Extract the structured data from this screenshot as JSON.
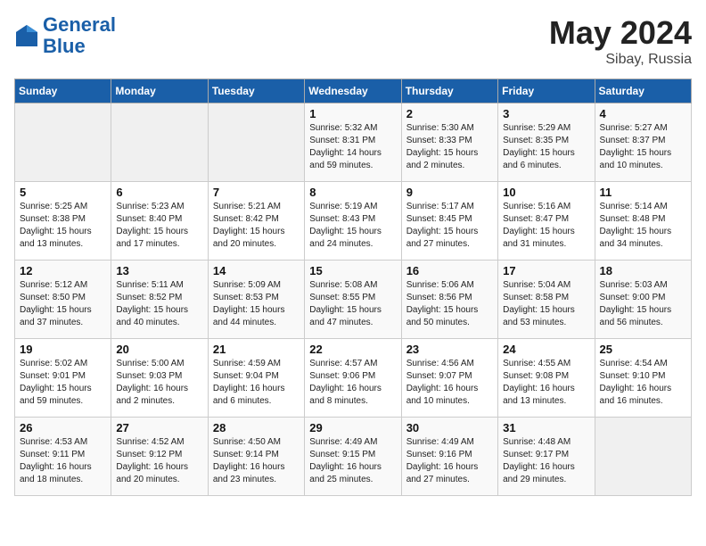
{
  "logo": {
    "line1": "General",
    "line2": "Blue"
  },
  "title": "May 2024",
  "location": "Sibay, Russia",
  "days_header": [
    "Sunday",
    "Monday",
    "Tuesday",
    "Wednesday",
    "Thursday",
    "Friday",
    "Saturday"
  ],
  "weeks": [
    [
      {
        "day": "",
        "info": ""
      },
      {
        "day": "",
        "info": ""
      },
      {
        "day": "",
        "info": ""
      },
      {
        "day": "1",
        "info": "Sunrise: 5:32 AM\nSunset: 8:31 PM\nDaylight: 14 hours\nand 59 minutes."
      },
      {
        "day": "2",
        "info": "Sunrise: 5:30 AM\nSunset: 8:33 PM\nDaylight: 15 hours\nand 2 minutes."
      },
      {
        "day": "3",
        "info": "Sunrise: 5:29 AM\nSunset: 8:35 PM\nDaylight: 15 hours\nand 6 minutes."
      },
      {
        "day": "4",
        "info": "Sunrise: 5:27 AM\nSunset: 8:37 PM\nDaylight: 15 hours\nand 10 minutes."
      }
    ],
    [
      {
        "day": "5",
        "info": "Sunrise: 5:25 AM\nSunset: 8:38 PM\nDaylight: 15 hours\nand 13 minutes."
      },
      {
        "day": "6",
        "info": "Sunrise: 5:23 AM\nSunset: 8:40 PM\nDaylight: 15 hours\nand 17 minutes."
      },
      {
        "day": "7",
        "info": "Sunrise: 5:21 AM\nSunset: 8:42 PM\nDaylight: 15 hours\nand 20 minutes."
      },
      {
        "day": "8",
        "info": "Sunrise: 5:19 AM\nSunset: 8:43 PM\nDaylight: 15 hours\nand 24 minutes."
      },
      {
        "day": "9",
        "info": "Sunrise: 5:17 AM\nSunset: 8:45 PM\nDaylight: 15 hours\nand 27 minutes."
      },
      {
        "day": "10",
        "info": "Sunrise: 5:16 AM\nSunset: 8:47 PM\nDaylight: 15 hours\nand 31 minutes."
      },
      {
        "day": "11",
        "info": "Sunrise: 5:14 AM\nSunset: 8:48 PM\nDaylight: 15 hours\nand 34 minutes."
      }
    ],
    [
      {
        "day": "12",
        "info": "Sunrise: 5:12 AM\nSunset: 8:50 PM\nDaylight: 15 hours\nand 37 minutes."
      },
      {
        "day": "13",
        "info": "Sunrise: 5:11 AM\nSunset: 8:52 PM\nDaylight: 15 hours\nand 40 minutes."
      },
      {
        "day": "14",
        "info": "Sunrise: 5:09 AM\nSunset: 8:53 PM\nDaylight: 15 hours\nand 44 minutes."
      },
      {
        "day": "15",
        "info": "Sunrise: 5:08 AM\nSunset: 8:55 PM\nDaylight: 15 hours\nand 47 minutes."
      },
      {
        "day": "16",
        "info": "Sunrise: 5:06 AM\nSunset: 8:56 PM\nDaylight: 15 hours\nand 50 minutes."
      },
      {
        "day": "17",
        "info": "Sunrise: 5:04 AM\nSunset: 8:58 PM\nDaylight: 15 hours\nand 53 minutes."
      },
      {
        "day": "18",
        "info": "Sunrise: 5:03 AM\nSunset: 9:00 PM\nDaylight: 15 hours\nand 56 minutes."
      }
    ],
    [
      {
        "day": "19",
        "info": "Sunrise: 5:02 AM\nSunset: 9:01 PM\nDaylight: 15 hours\nand 59 minutes."
      },
      {
        "day": "20",
        "info": "Sunrise: 5:00 AM\nSunset: 9:03 PM\nDaylight: 16 hours\nand 2 minutes."
      },
      {
        "day": "21",
        "info": "Sunrise: 4:59 AM\nSunset: 9:04 PM\nDaylight: 16 hours\nand 6 minutes."
      },
      {
        "day": "22",
        "info": "Sunrise: 4:57 AM\nSunset: 9:06 PM\nDaylight: 16 hours\nand 8 minutes."
      },
      {
        "day": "23",
        "info": "Sunrise: 4:56 AM\nSunset: 9:07 PM\nDaylight: 16 hours\nand 10 minutes."
      },
      {
        "day": "24",
        "info": "Sunrise: 4:55 AM\nSunset: 9:08 PM\nDaylight: 16 hours\nand 13 minutes."
      },
      {
        "day": "25",
        "info": "Sunrise: 4:54 AM\nSunset: 9:10 PM\nDaylight: 16 hours\nand 16 minutes."
      }
    ],
    [
      {
        "day": "26",
        "info": "Sunrise: 4:53 AM\nSunset: 9:11 PM\nDaylight: 16 hours\nand 18 minutes."
      },
      {
        "day": "27",
        "info": "Sunrise: 4:52 AM\nSunset: 9:12 PM\nDaylight: 16 hours\nand 20 minutes."
      },
      {
        "day": "28",
        "info": "Sunrise: 4:50 AM\nSunset: 9:14 PM\nDaylight: 16 hours\nand 23 minutes."
      },
      {
        "day": "29",
        "info": "Sunrise: 4:49 AM\nSunset: 9:15 PM\nDaylight: 16 hours\nand 25 minutes."
      },
      {
        "day": "30",
        "info": "Sunrise: 4:49 AM\nSunset: 9:16 PM\nDaylight: 16 hours\nand 27 minutes."
      },
      {
        "day": "31",
        "info": "Sunrise: 4:48 AM\nSunset: 9:17 PM\nDaylight: 16 hours\nand 29 minutes."
      },
      {
        "day": "",
        "info": ""
      }
    ]
  ]
}
